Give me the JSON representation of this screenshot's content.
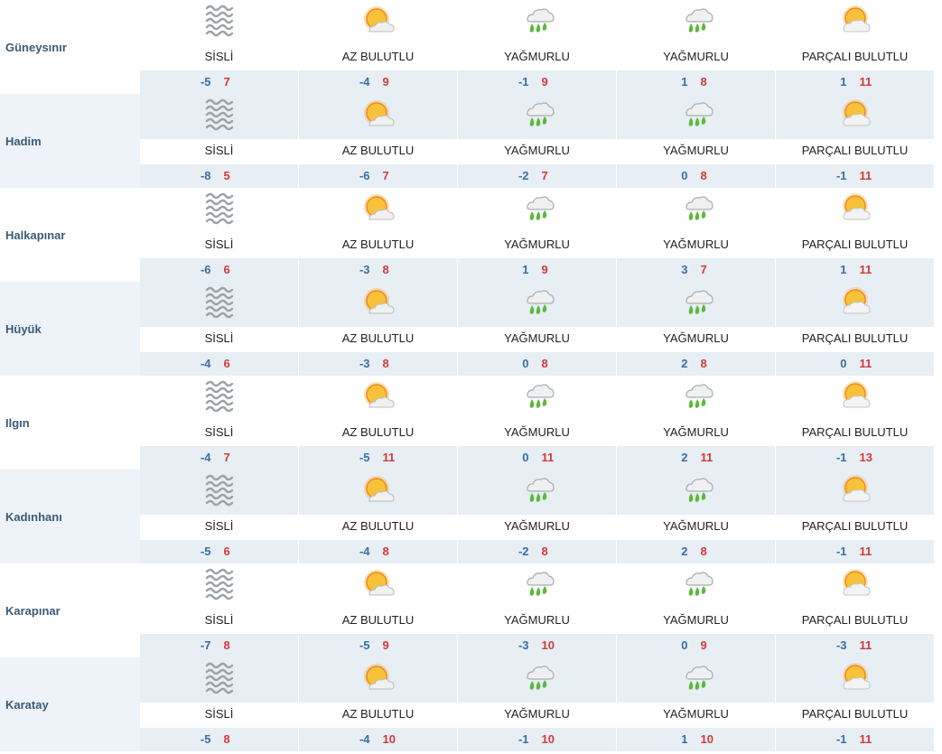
{
  "colors": {
    "min_temp": "#3a6ea5",
    "max_temp": "#d23a3a",
    "city_text": "#3c5a74"
  },
  "rows": [
    {
      "city": "Güneysınır",
      "days": [
        {
          "icon": "fog-icon",
          "desc": "SİSLİ",
          "min": "-5",
          "max": "7"
        },
        {
          "icon": "sun-cloud-icon",
          "desc": "AZ BULUTLU",
          "min": "-4",
          "max": "9"
        },
        {
          "icon": "rain-icon",
          "desc": "YAĞMURLU",
          "min": "-1",
          "max": "9"
        },
        {
          "icon": "rain-icon",
          "desc": "YAĞMURLU",
          "min": "1",
          "max": "8"
        },
        {
          "icon": "partly-cloudy-icon",
          "desc": "PARÇALI BULUTLU",
          "min": "1",
          "max": "11"
        }
      ]
    },
    {
      "city": "Hadim",
      "days": [
        {
          "icon": "fog-icon",
          "desc": "SİSLİ",
          "min": "-8",
          "max": "5"
        },
        {
          "icon": "sun-cloud-icon",
          "desc": "AZ BULUTLU",
          "min": "-6",
          "max": "7"
        },
        {
          "icon": "rain-icon",
          "desc": "YAĞMURLU",
          "min": "-2",
          "max": "7"
        },
        {
          "icon": "rain-icon",
          "desc": "YAĞMURLU",
          "min": "0",
          "max": "8"
        },
        {
          "icon": "partly-cloudy-icon",
          "desc": "PARÇALI BULUTLU",
          "min": "-1",
          "max": "11"
        }
      ]
    },
    {
      "city": "Halkapınar",
      "days": [
        {
          "icon": "fog-icon",
          "desc": "SİSLİ",
          "min": "-6",
          "max": "6"
        },
        {
          "icon": "sun-cloud-icon",
          "desc": "AZ BULUTLU",
          "min": "-3",
          "max": "8"
        },
        {
          "icon": "rain-icon",
          "desc": "YAĞMURLU",
          "min": "1",
          "max": "9"
        },
        {
          "icon": "rain-icon",
          "desc": "YAĞMURLU",
          "min": "3",
          "max": "7"
        },
        {
          "icon": "partly-cloudy-icon",
          "desc": "PARÇALI BULUTLU",
          "min": "1",
          "max": "11"
        }
      ]
    },
    {
      "city": "Hüyük",
      "days": [
        {
          "icon": "fog-icon",
          "desc": "SİSLİ",
          "min": "-4",
          "max": "6"
        },
        {
          "icon": "sun-cloud-icon",
          "desc": "AZ BULUTLU",
          "min": "-3",
          "max": "8"
        },
        {
          "icon": "rain-icon",
          "desc": "YAĞMURLU",
          "min": "0",
          "max": "8"
        },
        {
          "icon": "rain-icon",
          "desc": "YAĞMURLU",
          "min": "2",
          "max": "8"
        },
        {
          "icon": "partly-cloudy-icon",
          "desc": "PARÇALI BULUTLU",
          "min": "0",
          "max": "11"
        }
      ]
    },
    {
      "city": "Ilgın",
      "days": [
        {
          "icon": "fog-icon",
          "desc": "SİSLİ",
          "min": "-4",
          "max": "7"
        },
        {
          "icon": "sun-cloud-icon",
          "desc": "AZ BULUTLU",
          "min": "-5",
          "max": "11"
        },
        {
          "icon": "rain-icon",
          "desc": "YAĞMURLU",
          "min": "0",
          "max": "11"
        },
        {
          "icon": "rain-icon",
          "desc": "YAĞMURLU",
          "min": "2",
          "max": "11"
        },
        {
          "icon": "partly-cloudy-icon",
          "desc": "PARÇALI BULUTLU",
          "min": "-1",
          "max": "13"
        }
      ]
    },
    {
      "city": "Kadınhanı",
      "days": [
        {
          "icon": "fog-icon",
          "desc": "SİSLİ",
          "min": "-5",
          "max": "6"
        },
        {
          "icon": "sun-cloud-icon",
          "desc": "AZ BULUTLU",
          "min": "-4",
          "max": "8"
        },
        {
          "icon": "rain-icon",
          "desc": "YAĞMURLU",
          "min": "-2",
          "max": "8"
        },
        {
          "icon": "rain-icon",
          "desc": "YAĞMURLU",
          "min": "2",
          "max": "8"
        },
        {
          "icon": "partly-cloudy-icon",
          "desc": "PARÇALI BULUTLU",
          "min": "-1",
          "max": "11"
        }
      ]
    },
    {
      "city": "Karapınar",
      "days": [
        {
          "icon": "fog-icon",
          "desc": "SİSLİ",
          "min": "-7",
          "max": "8"
        },
        {
          "icon": "sun-cloud-icon",
          "desc": "AZ BULUTLU",
          "min": "-5",
          "max": "9"
        },
        {
          "icon": "rain-icon",
          "desc": "YAĞMURLU",
          "min": "-3",
          "max": "10"
        },
        {
          "icon": "rain-icon",
          "desc": "YAĞMURLU",
          "min": "0",
          "max": "9"
        },
        {
          "icon": "partly-cloudy-icon",
          "desc": "PARÇALI BULUTLU",
          "min": "-3",
          "max": "11"
        }
      ]
    },
    {
      "city": "Karatay",
      "days": [
        {
          "icon": "fog-icon",
          "desc": "SİSLİ",
          "min": "-5",
          "max": "8"
        },
        {
          "icon": "sun-cloud-icon",
          "desc": "AZ BULUTLU",
          "min": "-4",
          "max": "10"
        },
        {
          "icon": "rain-icon",
          "desc": "YAĞMURLU",
          "min": "-1",
          "max": "10"
        },
        {
          "icon": "rain-icon",
          "desc": "YAĞMURLU",
          "min": "1",
          "max": "10"
        },
        {
          "icon": "partly-cloudy-icon",
          "desc": "PARÇALI BULUTLU",
          "min": "-1",
          "max": "11"
        }
      ]
    }
  ]
}
